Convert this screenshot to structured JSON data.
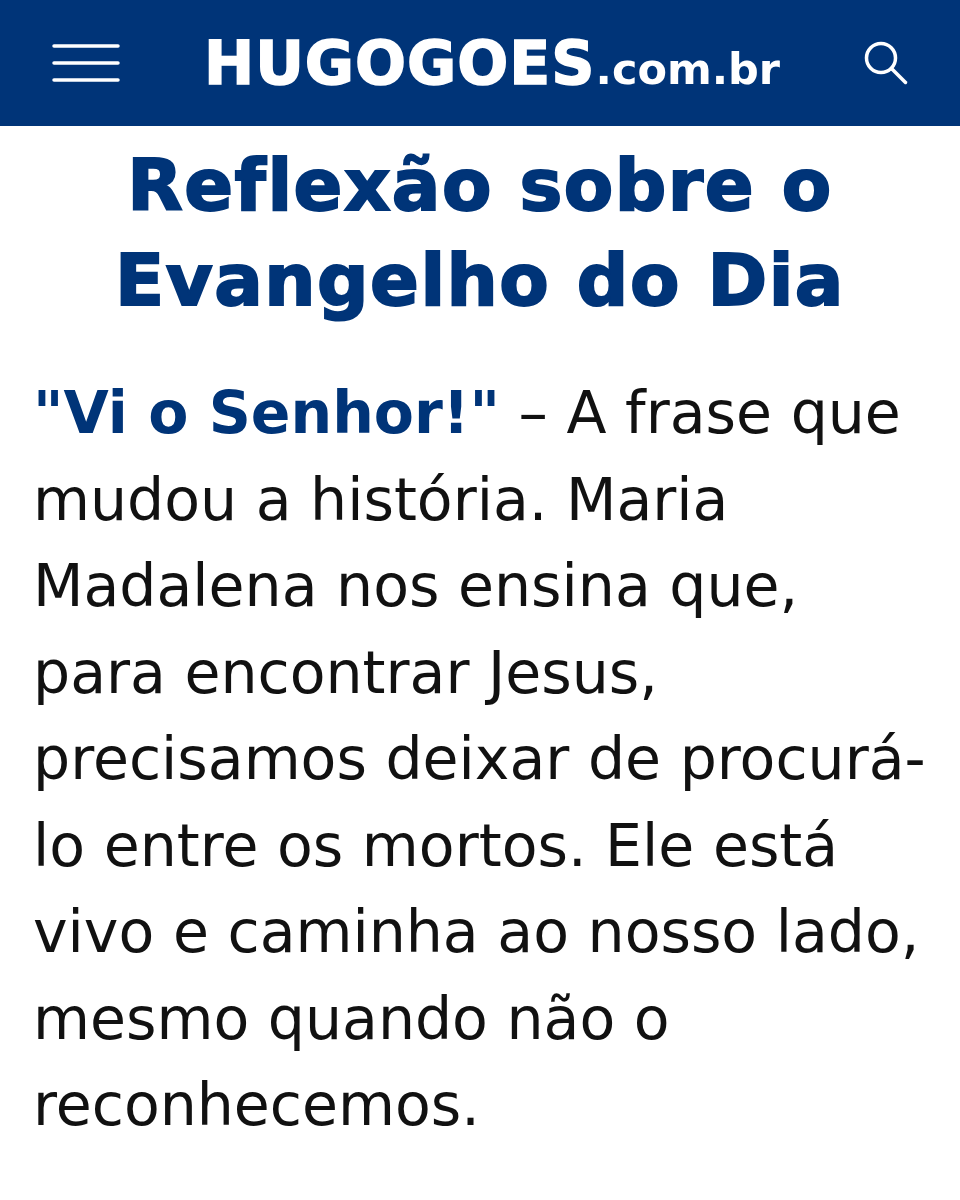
{
  "header": {
    "logo": {
      "name": "HUGOGOES",
      "domain": ".com.br"
    }
  },
  "article": {
    "title": "Reflexão sobre o Evangelho do Dia",
    "paragraph": "**\"Vi o Senhor!\"** – A frase que mudou a história. Maria Madalena nos ensina que, para encontrar Jesus, precisamos deixar de procurá-lo entre os mortos. Ele está vivo e caminha ao nosso lado, mesmo quando não o reconhecemos."
  }
}
